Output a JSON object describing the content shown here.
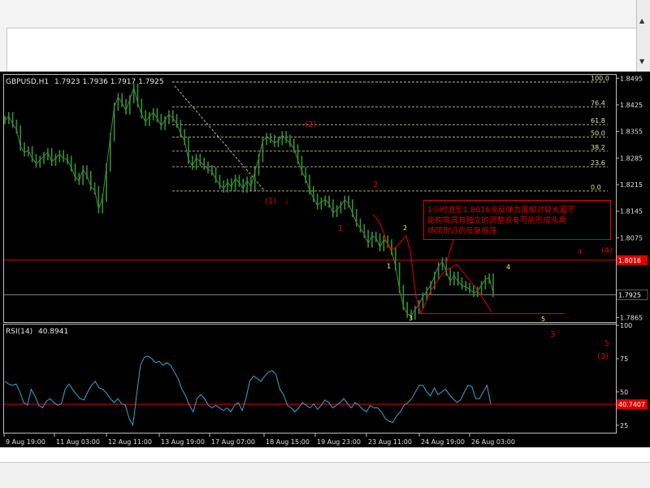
{
  "symbol_header": {
    "symbol": "GBPUSD,H1",
    "ohlc": "1.7923 1.7936 1.7917 1.7925"
  },
  "rsi_header": {
    "name": "RSI(14)",
    "value": "40.8941"
  },
  "annotation": {
    "line1": "1小时浪形1.8016点反弹力度相对较大若不",
    "line2": "能构筑具有独立的调整浪有可能形成头肩",
    "line3": "场顶附近的反复振荡"
  },
  "colors": {
    "background": "#000000",
    "grid": "#5c5c5c",
    "axis_text": "#e0e0e0",
    "bars": "#3a8d3a",
    "rsi_line": "#3aa6c9",
    "red": "#e00000",
    "fib": "#e0e0a0",
    "yellow": "#ffff33",
    "current_label_bg": "#e00000"
  },
  "chart_data": [
    {
      "type": "line",
      "title": "GBPUSD,H1",
      "price_axis_ticks": [
        "1.8495",
        "1.8425",
        "1.8355",
        "1.8285",
        "1.8215",
        "1.8145",
        "1.8075",
        "1.7925",
        "1.7865"
      ],
      "current_price_label": "1.7925",
      "resistance_label": "1.8016",
      "x_tick_labels": [
        "9 Aug 19:00",
        "11 Aug 03:00",
        "12 Aug 11:00",
        "13 Aug 19:00",
        "17 Aug 07:00",
        "18 Aug 15:00",
        "19 Aug 23:00",
        "23 Aug 11:00",
        "24 Aug 19:00",
        "26 Aug 03:00"
      ],
      "ylim": [
        1.7855,
        1.8502
      ],
      "resistance": 1.8016,
      "current": 1.7925,
      "series": [
        {
          "values": [
            1.8385,
            1.8395,
            1.8375,
            1.836,
            1.8315,
            1.83,
            1.8305,
            1.8285,
            1.827,
            1.828,
            1.829,
            1.83,
            1.8275,
            1.8285,
            1.8295,
            1.8285,
            1.828,
            1.826,
            1.8235,
            1.8225,
            1.8255,
            1.824,
            1.821,
            1.82,
            1.815,
            1.818,
            1.826,
            1.834,
            1.842,
            1.8445,
            1.843,
            1.841,
            1.844,
            1.847,
            1.843,
            1.84,
            1.838,
            1.8395,
            1.8405,
            1.839,
            1.837,
            1.8385,
            1.84,
            1.839,
            1.8375,
            1.835,
            1.833,
            1.828,
            1.8265,
            1.8285,
            1.8275,
            1.8265,
            1.8255,
            1.825,
            1.823,
            1.8215,
            1.8205,
            1.822,
            1.821,
            1.823,
            1.822,
            1.8205,
            1.8225,
            1.821,
            1.825,
            1.8285,
            1.833,
            1.834,
            1.8335,
            1.8325,
            1.833,
            1.8345,
            1.8335,
            1.8325,
            1.831,
            1.828,
            1.825,
            1.823,
            1.82,
            1.818,
            1.816,
            1.817,
            1.8175,
            1.8165,
            1.814,
            1.815,
            1.816,
            1.8175,
            1.8165,
            1.814,
            1.8115,
            1.81,
            1.8085,
            1.806,
            1.808,
            1.8075,
            1.805,
            1.807,
            1.806,
            1.804,
            1.8,
            1.794,
            1.7895,
            1.7875,
            1.787,
            1.7885,
            1.79,
            1.792,
            1.7935,
            1.795,
            1.7975,
            1.8,
            1.8012,
            1.7985,
            1.796,
            1.7975,
            1.796,
            1.795,
            1.7945,
            1.794,
            1.793,
            1.7935,
            1.795,
            1.7965,
            1.797,
            1.793
          ]
        }
      ],
      "fib_levels": [
        {
          "label": "100.0",
          "price": 1.8485
        },
        {
          "label": "76.4",
          "price": 1.842
        },
        {
          "label": "61.8",
          "price": 1.8373
        },
        {
          "label": "50.0",
          "price": 1.834
        },
        {
          "label": "38.2",
          "price": 1.8303
        },
        {
          "label": "23.6",
          "price": 1.8262
        },
        {
          "label": "0.0",
          "price": 1.8198
        }
      ],
      "wave_labels_red": [
        "(1)",
        "(2)",
        "1",
        "2",
        "3",
        "4",
        "5",
        "(3)",
        "(4)",
        "1",
        "i"
      ],
      "wave_labels_yellow": [
        "1",
        "2",
        "3",
        "4",
        "5"
      ]
    },
    {
      "type": "line",
      "title": "RSI(14)",
      "ylim": [
        20,
        100
      ],
      "y_ticks": [
        "100",
        "75",
        "50",
        "25"
      ],
      "current_label": "40.7407",
      "reference_level": 40.7407,
      "series": [
        {
          "values": [
            58,
            56,
            55,
            56,
            50,
            42,
            40,
            52,
            47,
            40,
            38,
            43,
            45,
            42,
            40,
            41,
            52,
            56,
            52,
            48,
            45,
            44,
            50,
            55,
            58,
            53,
            52,
            49,
            45,
            42,
            45,
            41,
            40,
            30,
            25,
            48,
            70,
            76,
            77,
            75,
            72,
            73,
            70,
            72,
            70,
            65,
            60,
            52,
            47,
            40,
            35,
            45,
            48,
            45,
            40,
            38,
            40,
            38,
            36,
            38,
            35,
            40,
            42,
            36,
            45,
            58,
            62,
            60,
            58,
            62,
            65,
            66,
            63,
            52,
            48,
            40,
            38,
            35,
            38,
            42,
            40,
            38,
            41,
            37,
            40,
            44,
            42,
            38,
            40,
            42,
            45,
            41,
            38,
            42,
            40,
            37,
            35,
            40,
            38,
            38,
            35,
            30,
            28,
            27,
            32,
            35,
            40,
            42,
            45,
            50,
            55,
            55,
            50,
            47,
            53,
            48,
            50,
            52,
            48,
            45,
            42,
            44,
            50,
            55,
            54,
            45,
            45,
            50,
            55,
            41
          ]
        }
      ]
    }
  ]
}
